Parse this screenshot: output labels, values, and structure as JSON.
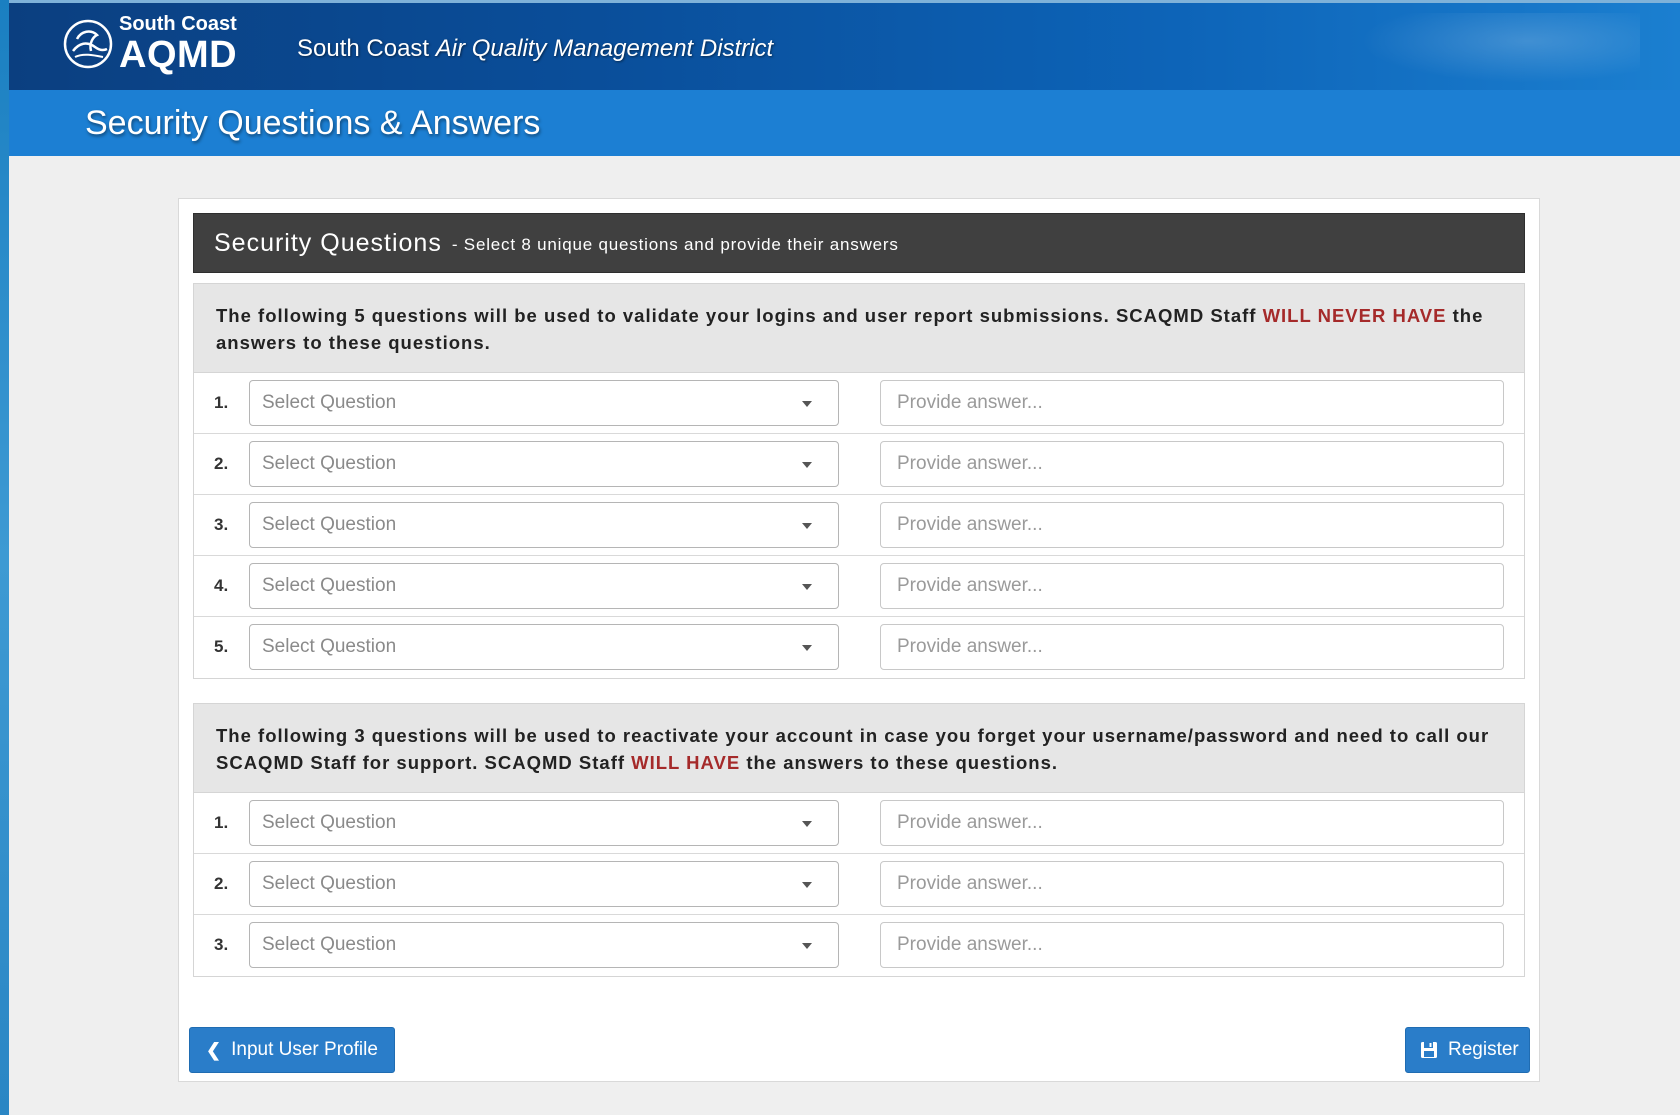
{
  "brand": {
    "logo_small": "South Coast",
    "logo_big": "AQMD",
    "agency_plain": "South Coast",
    "agency_italic": "Air Quality Management District"
  },
  "page": {
    "title": "Security Questions & Answers"
  },
  "panel": {
    "heading": "Security Questions",
    "subheading": "- Select 8 unique questions and provide their answers"
  },
  "section_login": {
    "intro_before": "The following 5 questions will be used to validate your logins and user report submissions. SCAQMD Staff ",
    "intro_warn": "WILL NEVER HAVE",
    "intro_after": " the answers to these questions.",
    "rows": [
      {
        "num": "1.",
        "select_value": "Select Question",
        "answer_placeholder": "Provide answer..."
      },
      {
        "num": "2.",
        "select_value": "Select Question",
        "answer_placeholder": "Provide answer..."
      },
      {
        "num": "3.",
        "select_value": "Select Question",
        "answer_placeholder": "Provide answer..."
      },
      {
        "num": "4.",
        "select_value": "Select Question",
        "answer_placeholder": "Provide answer..."
      },
      {
        "num": "5.",
        "select_value": "Select Question",
        "answer_placeholder": "Provide answer..."
      }
    ]
  },
  "section_recovery": {
    "intro_before": "The following 3 questions will be used to reactivate your account in case you forget your username/password and need to call our SCAQMD Staff for support. SCAQMD Staff ",
    "intro_warn": "WILL HAVE",
    "intro_after": " the answers to these questions.",
    "rows": [
      {
        "num": "1.",
        "select_value": "Select Question",
        "answer_placeholder": "Provide answer..."
      },
      {
        "num": "2.",
        "select_value": "Select Question",
        "answer_placeholder": "Provide answer..."
      },
      {
        "num": "3.",
        "select_value": "Select Question",
        "answer_placeholder": "Provide answer..."
      }
    ]
  },
  "buttons": {
    "back_label": "Input User Profile",
    "register_label": "Register"
  },
  "colors": {
    "header_dark": "#404040",
    "title_bar": "#1c7fd3",
    "button": "#2a7dc9",
    "warning": "#a52a2a"
  }
}
